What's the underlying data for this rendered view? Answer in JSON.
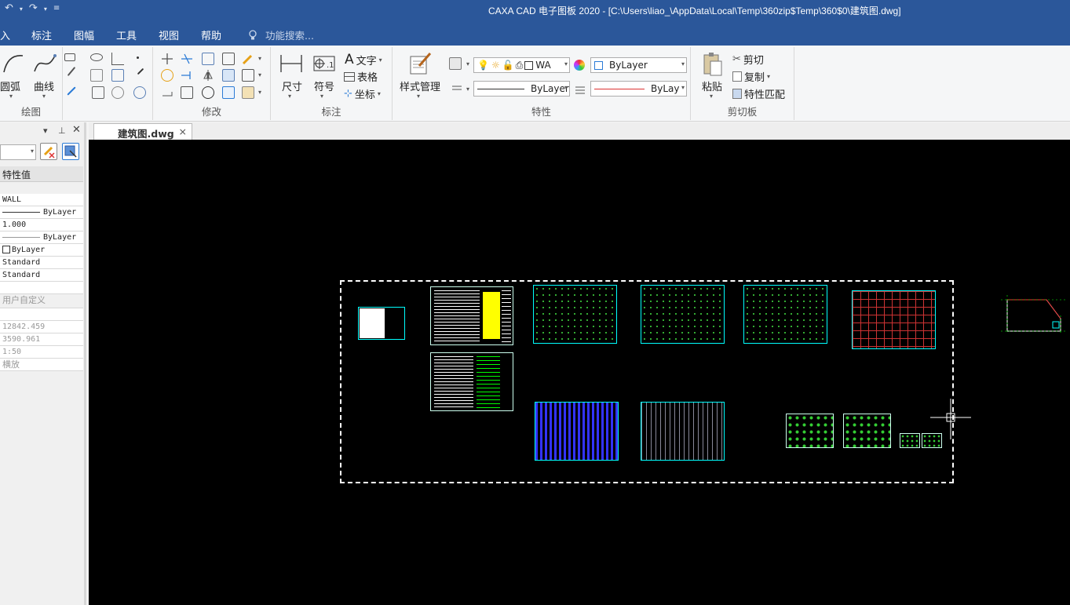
{
  "titlebar": {
    "title": "CAXA CAD 电子图板 2020 - [C:\\Users\\liao_\\AppData\\Local\\Temp\\360zip$Temp\\360$0\\建筑图.dwg]",
    "undo": "↶",
    "redo": "↷",
    "customize": "≡"
  },
  "menu": {
    "items": [
      "入",
      "标注",
      "图幅",
      "工具",
      "视图",
      "帮助"
    ],
    "search_placeholder": "功能搜索..."
  },
  "ribbon": {
    "draw": {
      "arc": "圆弧",
      "curve": "曲线",
      "label": "绘图"
    },
    "modify": {
      "label": "修改"
    },
    "annotate": {
      "dimension": "尺寸",
      "symbol": "符号",
      "text": "文字",
      "table": "表格",
      "coord": "坐标",
      "label": "标注"
    },
    "properties": {
      "style_manager": "样式管理",
      "layer_value": "WA",
      "color_value": "ByLayer",
      "linetype_value": "ByLayer",
      "lineweight_value": "ByLay",
      "label": "特性"
    },
    "clipboard": {
      "paste": "粘贴",
      "cut": "剪切",
      "copy": "复制",
      "match": "特性匹配",
      "label": "剪切板"
    }
  },
  "panel": {
    "header": "特性值",
    "rows": [
      "WALL",
      "ByLayer",
      "1.000",
      "ByLayer",
      "ByLayer",
      "Standard",
      "Standard"
    ],
    "section2": "用户自定义",
    "rows2": [
      "12842.459",
      "3590.961",
      "1:50",
      "横放"
    ]
  },
  "tab": {
    "name": "建筑图.dwg",
    "close": "×"
  }
}
